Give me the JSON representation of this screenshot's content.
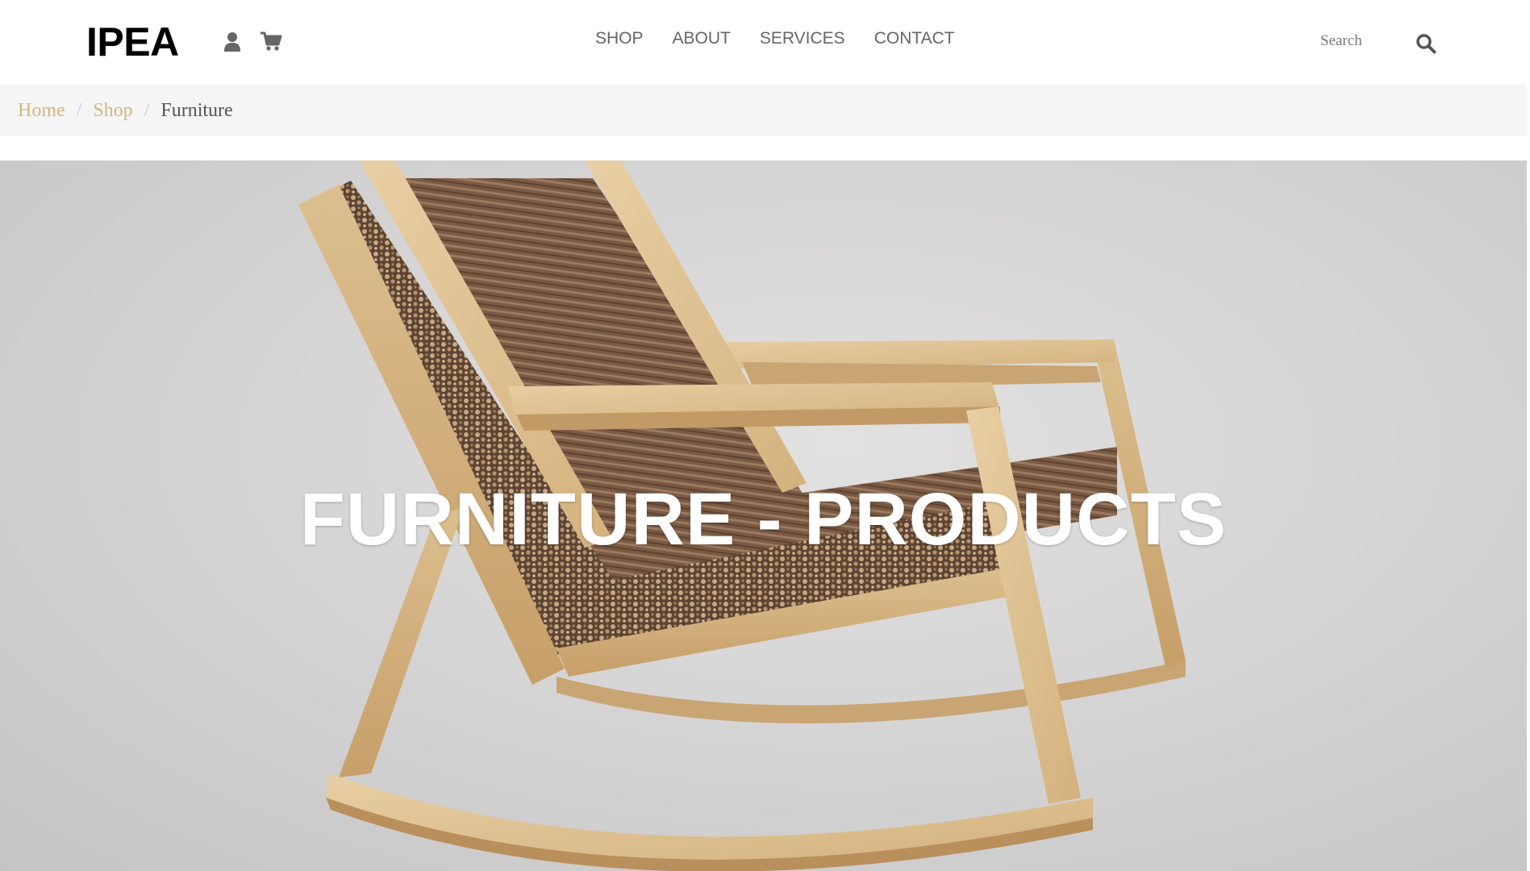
{
  "header": {
    "logo": "IPEA",
    "icons": [
      "user-icon",
      "cart-icon",
      "search-icon"
    ],
    "nav": [
      {
        "label": "SHOP"
      },
      {
        "label": "ABOUT"
      },
      {
        "label": "SERVICES"
      },
      {
        "label": "CONTACT"
      }
    ],
    "search": {
      "placeholder": "Search",
      "value": ""
    }
  },
  "breadcrumb": {
    "items": [
      {
        "label": "Home"
      },
      {
        "label": "Shop"
      },
      {
        "label": "Furniture"
      }
    ],
    "separator": "/"
  },
  "hero": {
    "title": "FURNITURE - PRODUCTS"
  },
  "colors": {
    "accent": "#d4b57e",
    "nav_text": "#666666",
    "breadcrumb_bg": "#f5f5f5"
  }
}
